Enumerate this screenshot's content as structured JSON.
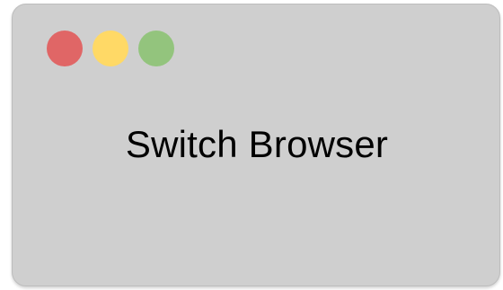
{
  "window": {
    "controls": [
      {
        "name": "close-button",
        "icon": "red-dot-icon",
        "color": "#e06666"
      },
      {
        "name": "minimize-button",
        "icon": "yellow-dot-icon",
        "color": "#ffd966"
      },
      {
        "name": "maximize-button",
        "icon": "green-dot-icon",
        "color": "#93c47d"
      }
    ],
    "title": "Switch Browser"
  },
  "colors": {
    "window_bg": "#cfcfcf",
    "border": "#bdbdbd"
  }
}
